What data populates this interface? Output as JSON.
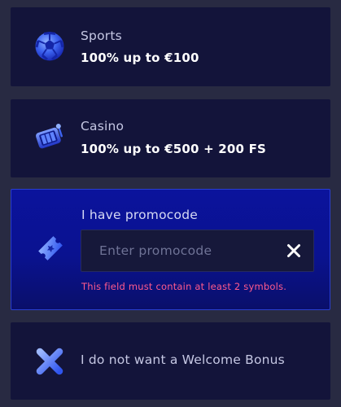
{
  "options": {
    "sports": {
      "title": "Sports",
      "subtitle": "100% up to €100",
      "icon": "soccer-ball-icon"
    },
    "casino": {
      "title": "Casino",
      "subtitle": "100% up to €500 + 200 FS",
      "icon": "slot-machine-icon"
    },
    "promocode": {
      "title": "I have promocode",
      "icon": "ticket-icon",
      "input_value": "",
      "placeholder": "Enter promocode",
      "clear_icon": "close-icon",
      "error": "This field must contain at least 2 symbols."
    },
    "no_bonus": {
      "title": "I do not want a Welcome Bonus",
      "icon": "x-icon"
    }
  },
  "colors": {
    "background": "#282a42",
    "card": "#13143a",
    "selected_card": "#0b139c",
    "accent_blue": "#3f6bff",
    "error": "#ff5a8c"
  }
}
